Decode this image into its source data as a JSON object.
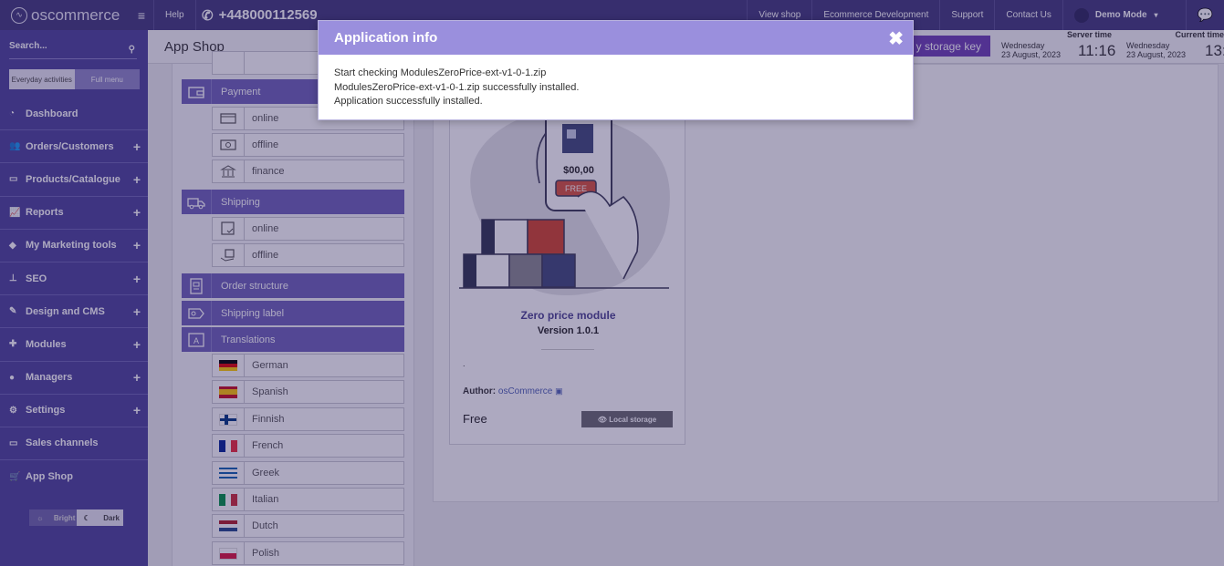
{
  "topbar": {
    "logo_text": "oscommerce",
    "help": "Help",
    "phone": "+448000112569",
    "links": [
      "View shop",
      "Ecommerce Development",
      "Support",
      "Contact Us"
    ],
    "user": "Demo Mode"
  },
  "sidebar": {
    "search_placeholder": "Search...",
    "menu_toggle": [
      "Everyday activities",
      "Full menu"
    ],
    "items": [
      {
        "label": "Dashboard",
        "icon": "dashboard-icon",
        "expandable": false
      },
      {
        "label": "Orders/Customers",
        "icon": "users-icon",
        "expandable": true
      },
      {
        "label": "Products/Catalogue",
        "icon": "folder-icon",
        "expandable": true
      },
      {
        "label": "Reports",
        "icon": "chart-icon",
        "expandable": true
      },
      {
        "label": "My Marketing tools",
        "icon": "tag-icon",
        "expandable": true
      },
      {
        "label": "SEO",
        "icon": "sitemap-icon",
        "expandable": true
      },
      {
        "label": "Design and CMS",
        "icon": "brush-icon",
        "expandable": true
      },
      {
        "label": "Modules",
        "icon": "puzzle-icon",
        "expandable": true
      },
      {
        "label": "Managers",
        "icon": "user-icon",
        "expandable": true
      },
      {
        "label": "Settings",
        "icon": "gears-icon",
        "expandable": true
      },
      {
        "label": "Sales channels",
        "icon": "monitor-icon",
        "expandable": false
      },
      {
        "label": "App Shop",
        "icon": "cart-icon",
        "expandable": false
      }
    ],
    "theme": [
      "Bright",
      "Dark"
    ]
  },
  "page": {
    "title": "App Shop",
    "storage_button": "y storage key",
    "server_time": {
      "label": "Server time",
      "day": "Wednesday",
      "date": "23 August, 2023",
      "time": "11:16"
    },
    "current_time": {
      "label": "Current time",
      "day": "Wednesday",
      "date": "23 August, 2023",
      "time": "13:"
    }
  },
  "categories": {
    "payment": {
      "label": "Payment",
      "subs": [
        "online",
        "offline",
        "finance"
      ]
    },
    "shipping": {
      "label": "Shipping",
      "subs": [
        "online",
        "offline"
      ]
    },
    "order_structure": "Order structure",
    "shipping_label": "Shipping label",
    "translations": {
      "label": "Translations",
      "languages": [
        "German",
        "Spanish",
        "Finnish",
        "French",
        "Greek",
        "Italian",
        "Dutch",
        "Polish"
      ]
    }
  },
  "card": {
    "name": "Zero price module",
    "version": "Version 1.0.1",
    "dot": ".",
    "author_label": "Author:",
    "author": "osCommerce",
    "price": "Free",
    "local_storage": "Local storage",
    "art_price": "$00,00",
    "art_free": "FREE"
  },
  "modal": {
    "title": "Application info",
    "close": "✖",
    "lines": [
      "Start checking ModulesZeroPrice-ext-v1-0-1.zip",
      "ModulesZeroPrice-ext-v1-0-1.zip successfully installed.",
      "Application successfully installed."
    ]
  },
  "colors": {
    "sidebar": "#4d4399",
    "topbar": "#41397b",
    "modal_header": "#9a8fdd",
    "category": "#6e62b9"
  }
}
